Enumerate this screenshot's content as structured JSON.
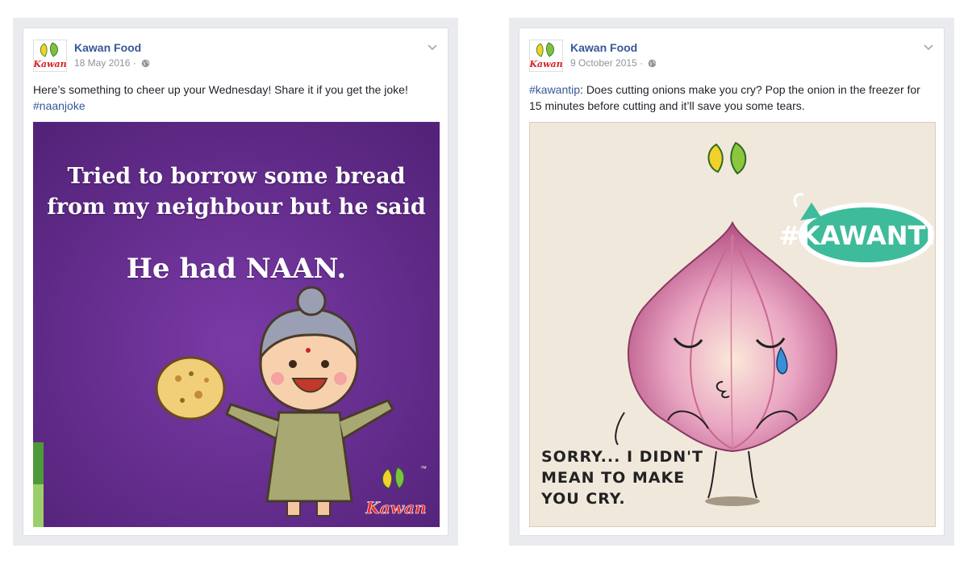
{
  "posts": [
    {
      "page_name": "Kawan Food",
      "date": "18 May 2016",
      "text": "Here’s something to cheer up your Wednesday! Share it if you get the joke!",
      "hashtag": "#naanjoke",
      "image": {
        "line1": "Tried to borrow some bread",
        "line2": "from my neighbour but he said",
        "punchline": "He had NAAN.",
        "brand_logo_text": "Kawan",
        "trademark": "™",
        "background_color": "#5e2a86"
      }
    },
    {
      "page_name": "Kawan Food",
      "date": "9 October 2015",
      "hashtag": "#kawantip",
      "text": ": Does cutting onions make you cry? Pop the onion in the freezer for 15 minutes before cutting and it’ll save you some tears.",
      "image": {
        "badge": "#KAWANTIP",
        "caption_line1": "SORRY... I DIDN'T",
        "caption_line2": "MEAN TO MAKE",
        "caption_line3": "YOU CRY.",
        "badge_color": "#3dbb9a",
        "background_color": "#f1e8dc"
      }
    }
  ],
  "icons": [
    "kawan-logo-icon",
    "globe-icon",
    "chevron-down-icon"
  ],
  "colors": {
    "link": "#365899",
    "meta": "#90949c",
    "frame": "#e9ebee"
  }
}
